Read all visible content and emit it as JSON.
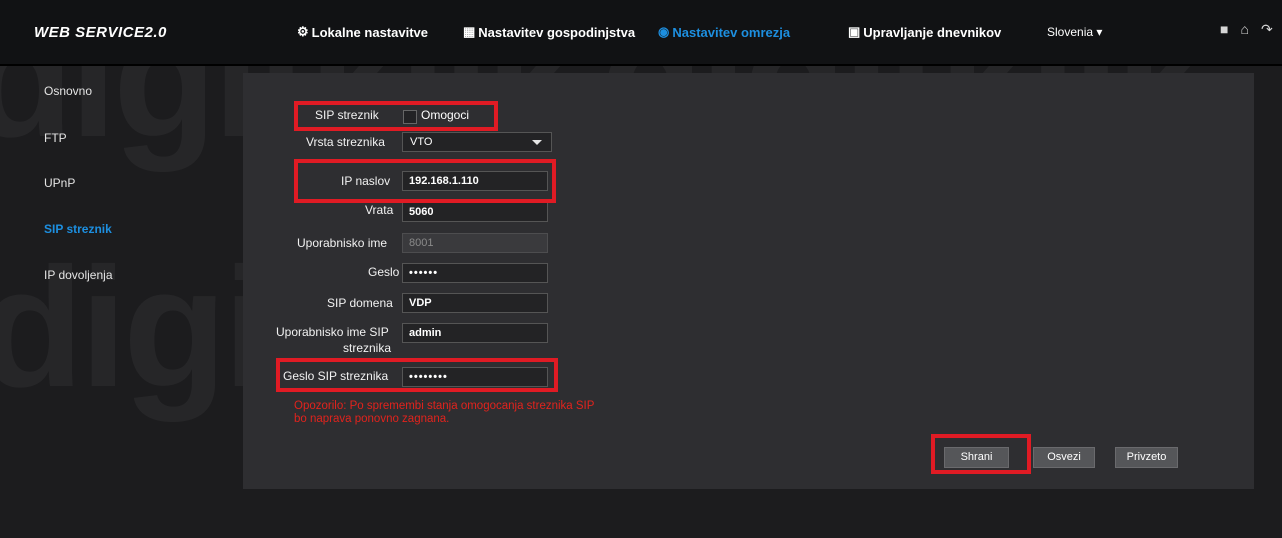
{
  "header": {
    "logo": "WEB SERVICE2.0",
    "nav": [
      {
        "icon": "⚙",
        "label": "Lokalne nastavitve"
      },
      {
        "icon": "▦",
        "label": "Nastavitev gospodinjstva"
      },
      {
        "icon": "◉",
        "label": "Nastavitev omrezja"
      },
      {
        "icon": "▣",
        "label": "Upravljanje dnevnikov"
      }
    ],
    "language": "Slovenia",
    "language_caret": "▾"
  },
  "sidebar": {
    "items": [
      {
        "label": "Osnovno"
      },
      {
        "label": "FTP"
      },
      {
        "label": "UPnP"
      },
      {
        "label": "SIP streznik"
      },
      {
        "label": "IP dovoljenja"
      }
    ]
  },
  "form": {
    "sip_server": {
      "label": "SIP streznik",
      "checkbox_label": "Omogoci"
    },
    "server_type": {
      "label": "Vrsta streznika",
      "value": "VTO"
    },
    "ip_address": {
      "label": "IP naslov",
      "value": "192.168.1.110"
    },
    "port": {
      "label": "Vrata",
      "value": "5060"
    },
    "username": {
      "label": "Uporabnisko ime",
      "value": "8001"
    },
    "password": {
      "label": "Geslo",
      "value": "••••••"
    },
    "sip_domain": {
      "label": "SIP domena",
      "value": "VDP"
    },
    "sip_server_username": {
      "label_line1": "Uporabnisko ime SIP",
      "label_line2": "streznika",
      "value": "admin"
    },
    "sip_server_password": {
      "label": "Geslo SIP streznika",
      "value": "••••••••"
    },
    "warning_line1": "Opozorilo: Po spremembi stanja omogocanja streznika SIP",
    "warning_line2": "bo naprava ponovno zagnana."
  },
  "buttons": {
    "save": "Shrani",
    "refresh": "Osvezi",
    "default": "Privzeto"
  },
  "watermark": {
    "text": "digitklik"
  },
  "colors": {
    "accent": "#1d8fe0",
    "highlight": "#e01b24",
    "warning": "#e1231d"
  }
}
